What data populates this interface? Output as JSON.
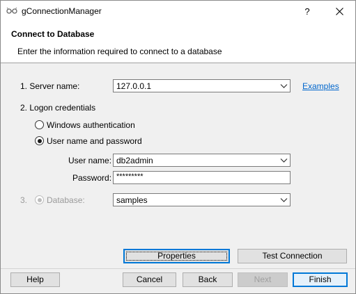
{
  "window": {
    "title": "gConnectionManager",
    "help_glyph": "?",
    "app_icon": "connection-plug-icon",
    "close_icon": "close-icon"
  },
  "header": {
    "title": "Connect to Database",
    "subtitle": "Enter the information required to connect to a database"
  },
  "form": {
    "server": {
      "label": "1. Server name:",
      "value": "127.0.0.1",
      "link": "Examples"
    },
    "logon": {
      "label": "2. Logon credentials",
      "options": [
        {
          "label": "Windows authentication",
          "checked": false
        },
        {
          "label": "User name and password",
          "checked": true
        }
      ],
      "username_label": "User name:",
      "username_value": "db2admin",
      "password_label": "Password:",
      "password_value": "*********"
    },
    "database": {
      "number": "3.",
      "label": "Database:",
      "value": "samples",
      "enabled": false
    }
  },
  "buttons": {
    "properties": "Properties",
    "test_connection": "Test Connection",
    "help": "Help",
    "cancel": "Cancel",
    "back": "Back",
    "next": "Next",
    "finish": "Finish"
  },
  "colors": {
    "accent": "#0078d7",
    "link": "#0066cc",
    "dialog_bg": "#f0f0f0",
    "disabled_text": "#9a9a9a"
  }
}
